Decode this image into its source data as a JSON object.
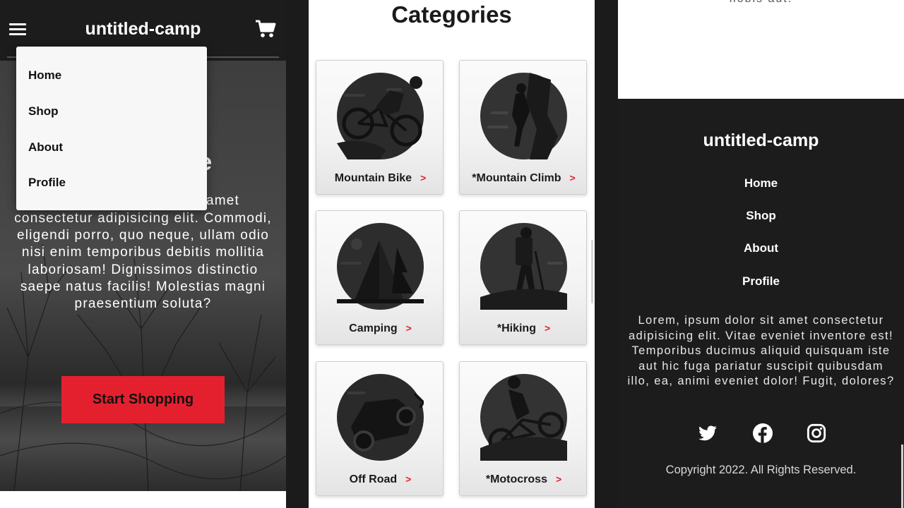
{
  "home": {
    "brand": "untitled-camp",
    "hero_heading_tail": "re",
    "hero_line1_tail": "amet",
    "hero_text": "consectetur adipisicing elit. Commodi, eligendi porro, quo neque, ullam odio nisi enim temporibus debitis mollitia laboriosam! Dignissimos distinctio saepe natus facilis! Molestias magni praesentium soluta?",
    "cta_label": "Start Shopping",
    "menu": [
      "Home",
      "Shop",
      "About",
      "Profile"
    ]
  },
  "categories": {
    "title": "Categories",
    "arrow": ">",
    "items": [
      {
        "label": "Mountain Bike",
        "icon": "mountain-bike-icon"
      },
      {
        "label": "*Mountain Climb",
        "icon": "mountain-climb-icon"
      },
      {
        "label": "Camping",
        "icon": "camping-tent-icon"
      },
      {
        "label": "*Hiking",
        "icon": "hiker-icon"
      },
      {
        "label": "Off Road",
        "icon": "off-road-jeep-icon"
      },
      {
        "label": "*Motocross",
        "icon": "motocross-icon"
      }
    ]
  },
  "footer": {
    "top_cut_text": "nobis aut.",
    "brand": "untitled-camp",
    "nav": [
      "Home",
      "Shop",
      "About",
      "Profile"
    ],
    "text": "Lorem, ipsum dolor sit amet consectetur adipisicing elit. Vitae eveniet inventore est! Temporibus ducimus aliquid quisquam iste aut hic fuga pariatur suscipit quibusdam illo, ea, animi eveniet dolor! Fugit, dolores?",
    "social": [
      "twitter-icon",
      "facebook-icon",
      "instagram-icon"
    ],
    "copyright": "Copyright 2022. All Rights Reserved."
  },
  "colors": {
    "accent": "#e5202e",
    "dark": "#1c1c1c"
  }
}
